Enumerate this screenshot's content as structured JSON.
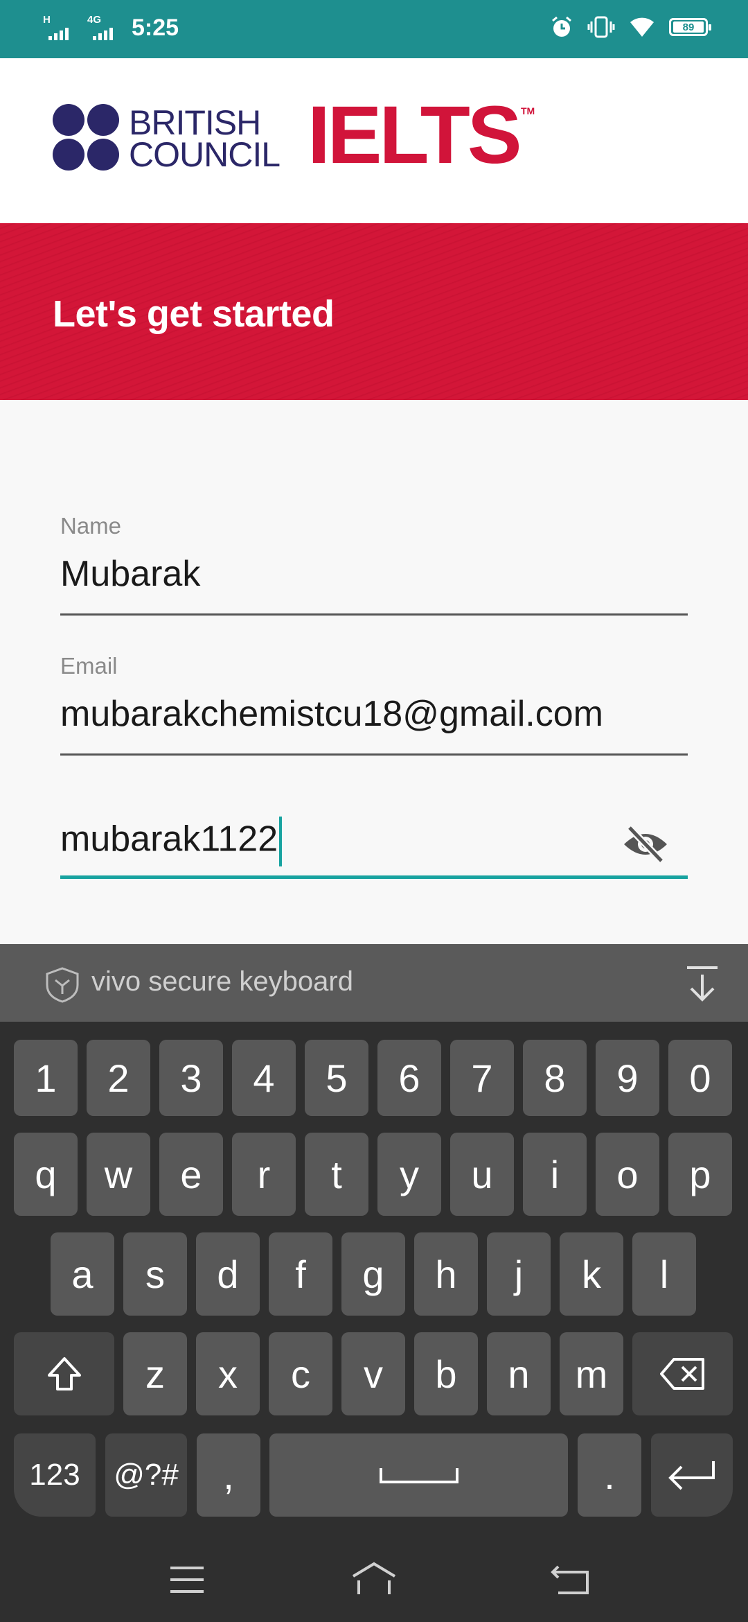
{
  "status_bar": {
    "sim1_label": "H",
    "sim2_label": "4G",
    "time": "5:25",
    "battery": "89"
  },
  "header": {
    "brand_line1": "BRITISH",
    "brand_line2": "COUNCIL",
    "product": "IELTS",
    "trademark": "TM"
  },
  "banner": {
    "title": "Let's get started"
  },
  "form": {
    "name_label": "Name",
    "name_value": "Mubarak",
    "email_label": "Email",
    "email_value": "mubarakchemistcu18@gmail.com",
    "password_value": "mubarak1122"
  },
  "keyboard": {
    "title": "vivo secure keyboard",
    "row_numbers": [
      "1",
      "2",
      "3",
      "4",
      "5",
      "6",
      "7",
      "8",
      "9",
      "0"
    ],
    "row1": [
      "q",
      "w",
      "e",
      "r",
      "t",
      "y",
      "u",
      "i",
      "o",
      "p"
    ],
    "row2": [
      "a",
      "s",
      "d",
      "f",
      "g",
      "h",
      "j",
      "k",
      "l"
    ],
    "row3": [
      "z",
      "x",
      "c",
      "v",
      "b",
      "n",
      "m"
    ],
    "bottom": {
      "numbers": "123",
      "symbols": "@?#",
      "comma": ",",
      "period": "."
    }
  },
  "colors": {
    "status_bar": "#1e8f8f",
    "brand_navy": "#2b2768",
    "brand_red": "#d1143a",
    "accent": "#18a3a0"
  },
  "icons": [
    "alarm-icon",
    "vibrate-icon",
    "wifi-icon",
    "battery-icon",
    "password-visibility-off-icon",
    "shield-icon",
    "keyboard-collapse-icon",
    "shift-icon",
    "backspace-icon",
    "enter-icon",
    "menu-icon",
    "home-icon",
    "back-icon"
  ]
}
